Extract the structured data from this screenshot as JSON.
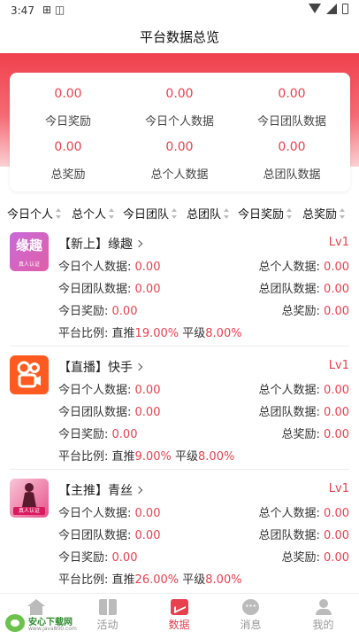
{
  "status_bar": {
    "time": "3:47",
    "left_icons": "⊞ ◫"
  },
  "header": {
    "title": "平台数据总览"
  },
  "summary": {
    "items": [
      {
        "value": "0.00",
        "label": "今日奖励"
      },
      {
        "value": "0.00",
        "label": "今日个人数据"
      },
      {
        "value": "0.00",
        "label": "今日团队数据"
      },
      {
        "value": "0.00",
        "label": "总奖励"
      },
      {
        "value": "0.00",
        "label": "总个人数据"
      },
      {
        "value": "0.00",
        "label": "总团队数据"
      }
    ]
  },
  "sort_bar": {
    "items": [
      "今日个人",
      "总个人",
      "今日团队",
      "总团队",
      "今日奖励",
      "总奖励"
    ]
  },
  "platforms": [
    {
      "avatar": {
        "big": "缘趣",
        "small": "真人认证"
      },
      "title": "【新上】缘趣",
      "level": "Lv1",
      "today_personal_label": "今日个人数据:",
      "today_personal_value": "0.00",
      "total_personal_label": "总个人数据:",
      "total_personal_value": "0.00",
      "today_team_label": "今日团队数据:",
      "today_team_value": "0.00",
      "total_team_label": "总团队数据:",
      "total_team_value": "0.00",
      "today_reward_label": "今日奖励:",
      "today_reward_value": "0.00",
      "total_reward_label": "总奖励:",
      "total_reward_value": "0.00",
      "ratio_label": "平台比例:",
      "direct_label": "直推",
      "direct_value": "19.00%",
      "peer_label": "平级",
      "peer_value": "8.00%"
    },
    {
      "avatar": {
        "big": "",
        "small": ""
      },
      "title": "【直播】快手",
      "level": "Lv1",
      "today_personal_label": "今日个人数据:",
      "today_personal_value": "0.00",
      "total_personal_label": "总个人数据:",
      "total_personal_value": "0.00",
      "today_team_label": "今日团队数据:",
      "today_team_value": "0.00",
      "total_team_label": "总团队数据:",
      "total_team_value": "0.00",
      "today_reward_label": "今日奖励:",
      "today_reward_value": "0.00",
      "total_reward_label": "总奖励:",
      "total_reward_value": "0.00",
      "ratio_label": "平台比例:",
      "direct_label": "直推",
      "direct_value": "9.00%",
      "peer_label": "平级",
      "peer_value": "8.00%"
    },
    {
      "avatar": {
        "big": "",
        "small": "真人认证"
      },
      "title": "【主推】青丝",
      "level": "Lv1",
      "today_personal_label": "今日个人数据:",
      "today_personal_value": "0.00",
      "total_personal_label": "总个人数据:",
      "total_personal_value": "0.00",
      "today_team_label": "今日团队数据:",
      "today_team_value": "0.00",
      "total_team_label": "总团队数据:",
      "total_team_value": "0.00",
      "today_reward_label": "今日奖励:",
      "today_reward_value": "0.00",
      "total_reward_label": "总奖励:",
      "total_reward_value": "0.00",
      "ratio_label": "平台比例:",
      "direct_label": "直推",
      "direct_value": "26.00%",
      "peer_label": "平级",
      "peer_value": "8.00%"
    }
  ],
  "tab_bar": {
    "active": "数据",
    "items": [
      {
        "label": "",
        "icon": "home-icon"
      },
      {
        "label": "活动",
        "icon": "gift-icon"
      },
      {
        "label": "数据",
        "icon": "chart-icon"
      },
      {
        "label": "消息",
        "icon": "message-icon"
      },
      {
        "label": "我的",
        "icon": "user-icon"
      }
    ]
  },
  "watermark": {
    "text": "安心下载网",
    "url": "www.java800.com"
  },
  "colors": {
    "accent": "#e8414d",
    "header_red": "#f0414d"
  }
}
